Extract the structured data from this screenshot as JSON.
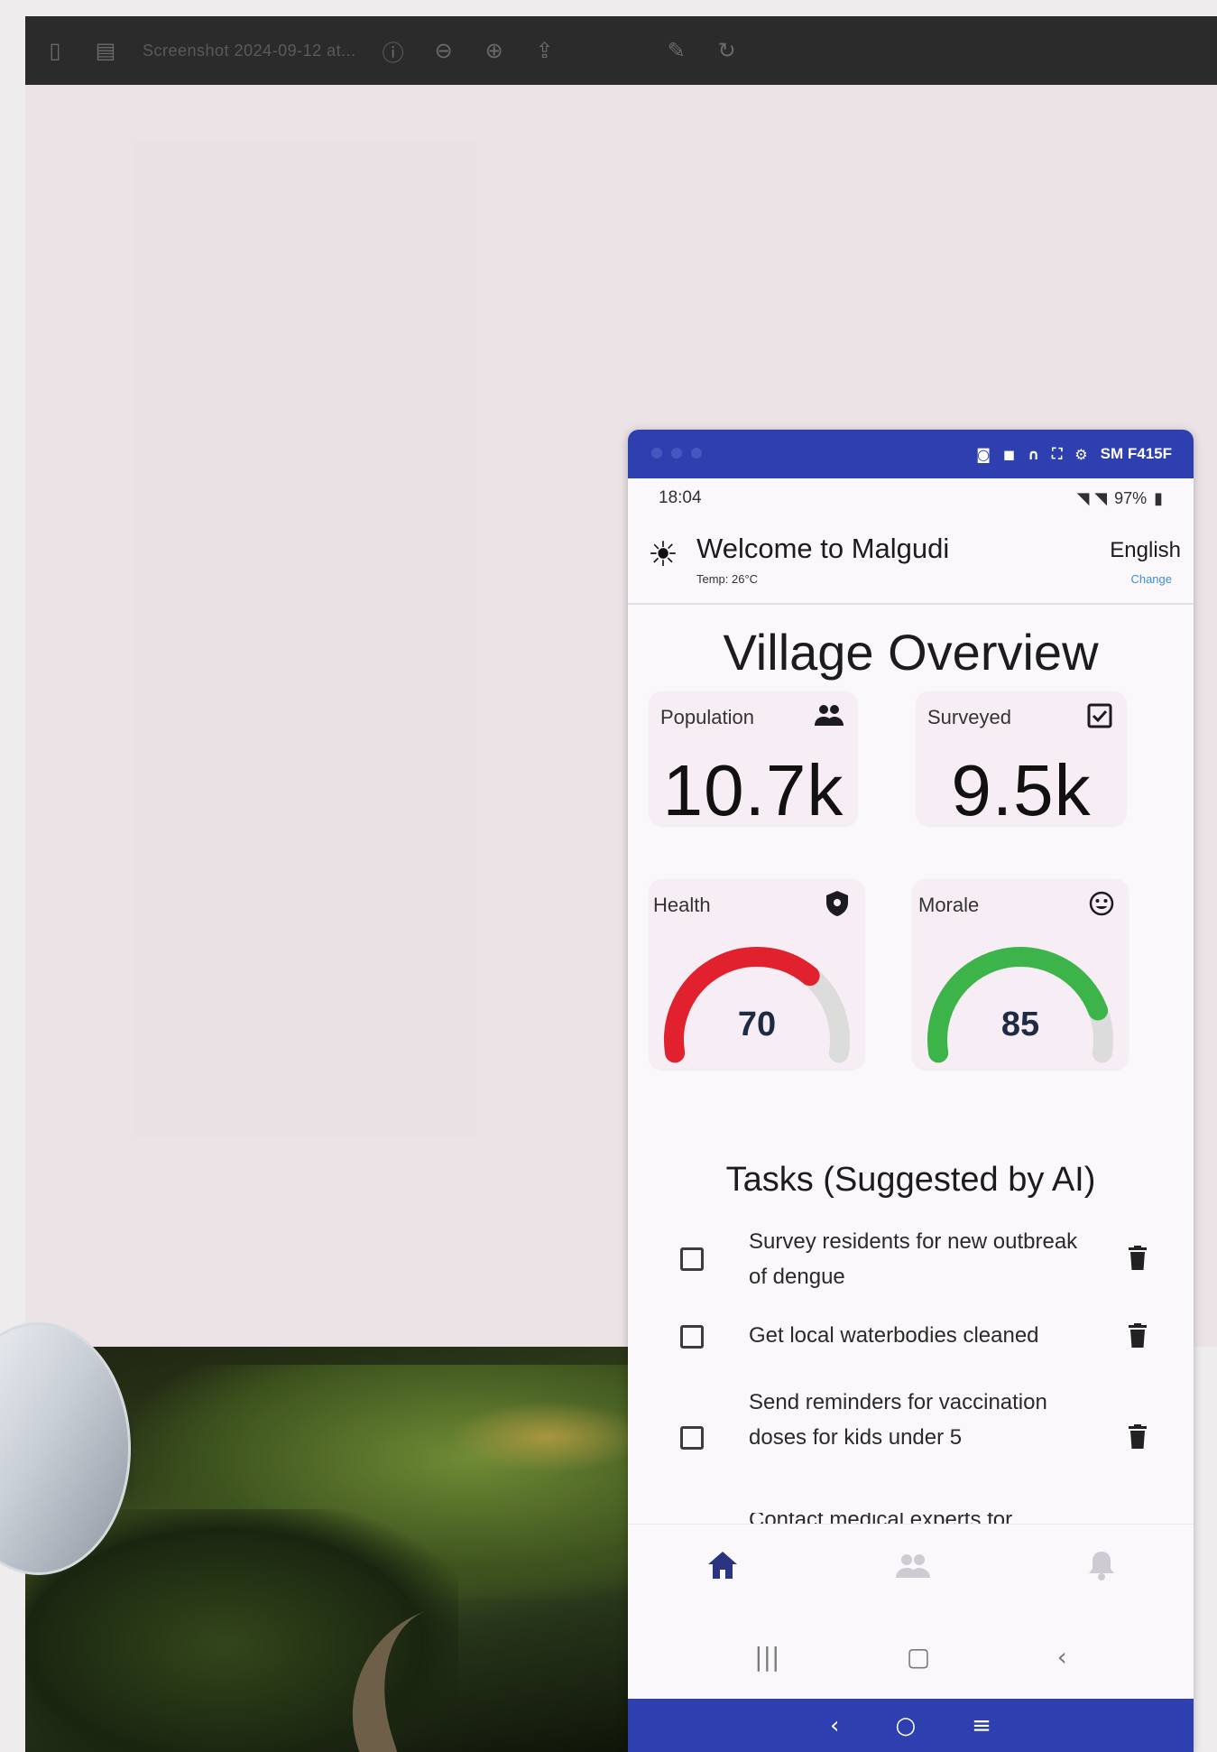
{
  "mac_window": {
    "document_title": "Screenshot 2024-09-12 at..."
  },
  "mirror_bar": {
    "device_name": "SM F415F"
  },
  "status_bar": {
    "time": "18:04",
    "battery": "97%"
  },
  "header": {
    "welcome": "Welcome to Malgudi",
    "temperature": "Temp: 26°C",
    "language": "English",
    "change_label": "Change"
  },
  "overview": {
    "title": "Village Overview",
    "population": {
      "label": "Population",
      "value": "10.7k",
      "icon": "people-icon"
    },
    "surveyed": {
      "label": "Surveyed",
      "value": "9.5k",
      "icon": "checkbox-icon"
    },
    "health": {
      "label": "Health",
      "value": "70",
      "level": 70,
      "max": 100,
      "color": "#e1222e",
      "icon": "shield-icon"
    },
    "morale": {
      "label": "Morale",
      "value": "85",
      "level": 85,
      "max": 100,
      "color": "#3cb44a",
      "icon": "smiley-icon"
    }
  },
  "tasks": {
    "title": "Tasks (Suggested by AI)",
    "items": [
      {
        "text": "Survey residents for new outbreak of dengue"
      },
      {
        "text": "Get local waterbodies cleaned"
      },
      {
        "text": "Send reminders for vaccination doses for kids under 5"
      },
      {
        "text": "Contact medical experts for"
      }
    ]
  },
  "bottom_nav": [
    {
      "icon": "home-icon",
      "active": true
    },
    {
      "icon": "people-icon",
      "active": false
    },
    {
      "icon": "bell-icon",
      "active": false
    }
  ],
  "colors": {
    "mirror_blue": "#2e3fb0",
    "gauge_track": "#dcdcdc",
    "nav_active": "#2b3480"
  }
}
